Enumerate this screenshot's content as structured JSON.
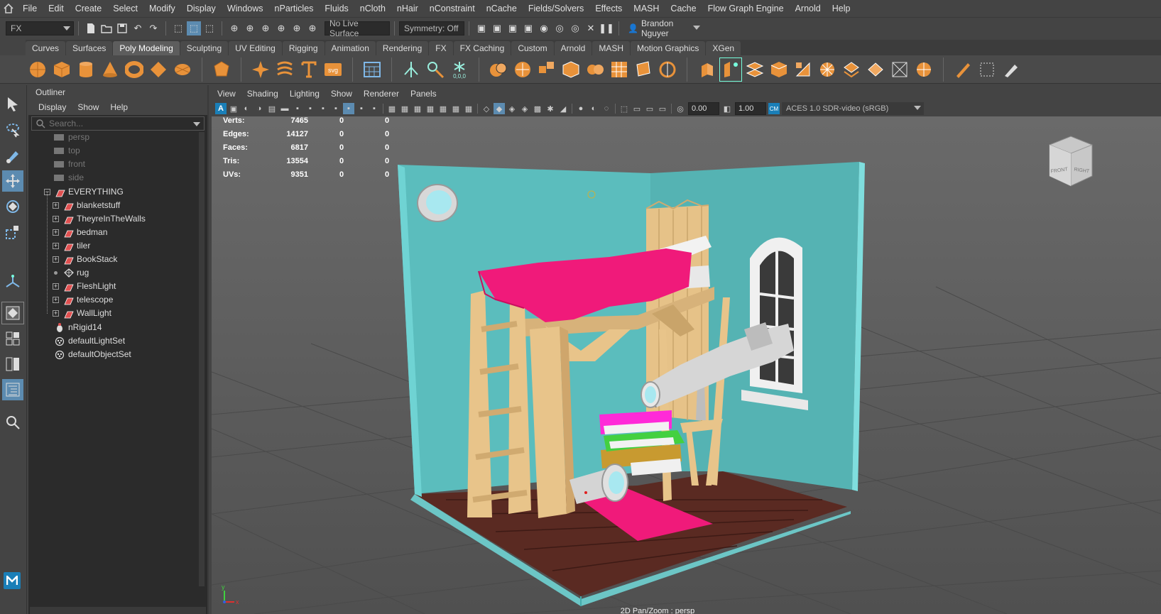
{
  "menubar": {
    "items": [
      "File",
      "Edit",
      "Create",
      "Select",
      "Modify",
      "Display",
      "Windows",
      "nParticles",
      "Fluids",
      "nCloth",
      "nHair",
      "nConstraint",
      "nCache",
      "Fields/Solvers",
      "Effects",
      "MASH",
      "Cache",
      "Flow Graph Engine",
      "Arnold",
      "Help"
    ]
  },
  "statusline": {
    "menuset": "FX",
    "live_surface": "No Live Surface",
    "symmetry": "Symmetry: Off",
    "user": "Brandon Nguyer"
  },
  "shelf": {
    "tabs": [
      "Curves",
      "Surfaces",
      "Poly Modeling",
      "Sculpting",
      "UV Editing",
      "Rigging",
      "Animation",
      "Rendering",
      "FX",
      "FX Caching",
      "Custom",
      "Arnold",
      "MASH",
      "Motion Graphics",
      "XGen"
    ],
    "active_tab": "Poly Modeling",
    "accent_color": "#e8923a"
  },
  "outliner": {
    "title": "Outliner",
    "menu": [
      "Display",
      "Show",
      "Help"
    ],
    "search_placeholder": "Search...",
    "items": [
      {
        "label": "persp",
        "type": "camera",
        "dim": true
      },
      {
        "label": "top",
        "type": "camera",
        "dim": true
      },
      {
        "label": "front",
        "type": "camera",
        "dim": true
      },
      {
        "label": "side",
        "type": "camera",
        "dim": true
      },
      {
        "label": "EVERYTHING",
        "type": "group"
      },
      {
        "label": "blanketstuff",
        "type": "group"
      },
      {
        "label": "TheyreInTheWalls",
        "type": "group"
      },
      {
        "label": "bedman",
        "type": "group"
      },
      {
        "label": "tiler",
        "type": "group"
      },
      {
        "label": "BookStack",
        "type": "group"
      },
      {
        "label": "rug",
        "type": "mesh"
      },
      {
        "label": "FleshLight",
        "type": "group"
      },
      {
        "label": "telescope",
        "type": "group"
      },
      {
        "label": "WallLight",
        "type": "group"
      },
      {
        "label": "nRigid14",
        "type": "nrigid"
      },
      {
        "label": "defaultLightSet",
        "type": "set"
      },
      {
        "label": "defaultObjectSet",
        "type": "set"
      }
    ]
  },
  "viewport": {
    "menu": [
      "View",
      "Shading",
      "Lighting",
      "Show",
      "Renderer",
      "Panels"
    ],
    "exposure": "0.00",
    "gamma": "1.00",
    "color_space": "ACES 1.0 SDR-video (sRGB)",
    "hud": [
      {
        "label": "Verts:",
        "values": [
          "7465",
          "0",
          "0"
        ]
      },
      {
        "label": "Edges:",
        "values": [
          "14127",
          "0",
          "0"
        ]
      },
      {
        "label": "Faces:",
        "values": [
          "6817",
          "0",
          "0"
        ]
      },
      {
        "label": "Tris:",
        "values": [
          "13554",
          "0",
          "0"
        ]
      },
      {
        "label": "UVs:",
        "values": [
          "9351",
          "0",
          "0"
        ]
      }
    ],
    "viewcube_front": "FRONT",
    "viewcube_right": "RIGHT",
    "status": "2D Pan/Zoom : persp",
    "axis_x": "x",
    "axis_y": "y",
    "scene_colors": {
      "wall": "#5bbdbd",
      "floor": "#5a2a22",
      "wood": "#e8c48a",
      "blanket": "#f01a7a",
      "telescope": "#d0d0d0"
    }
  }
}
